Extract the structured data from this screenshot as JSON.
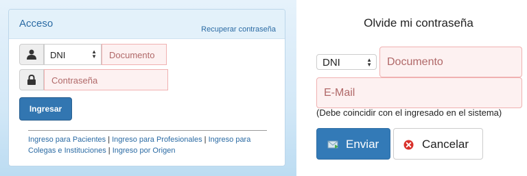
{
  "login": {
    "title": "Acceso",
    "recover_link": "Recuperar contraseña",
    "doc_type_selected": "DNI",
    "document_placeholder": "Documento",
    "password_placeholder": "Contraseña",
    "submit_label": "Ingresar",
    "links": [
      {
        "label": "Ingreso para Pacientes"
      },
      {
        "label": "Ingreso para Profesionales"
      },
      {
        "label": "Ingreso para Colegas e Instituciones"
      },
      {
        "label": "Ingreso por Origen"
      }
    ],
    "separator": "|"
  },
  "forgot": {
    "title": "Olvide mi contraseña",
    "doc_type_selected": "DNI",
    "document_placeholder": "Documento",
    "email_placeholder": "E-Mail",
    "note": "(Debe coincidir con el ingresado en el sistema)",
    "send_label": "Enviar",
    "cancel_label": "Cancelar"
  },
  "icons": {
    "user": "user-icon",
    "lock": "lock-icon",
    "select_arrows": "select-arrows-icon",
    "send": "envelope-send-icon",
    "cancel": "cancel-circle-icon"
  },
  "colors": {
    "primary": "#337ab7",
    "panel_heading": "#e3f1fa",
    "link": "#2a6aa3",
    "error_border": "#f0b0b0",
    "error_bg": "#fdf1f1",
    "cancel_red": "#d9312b"
  }
}
